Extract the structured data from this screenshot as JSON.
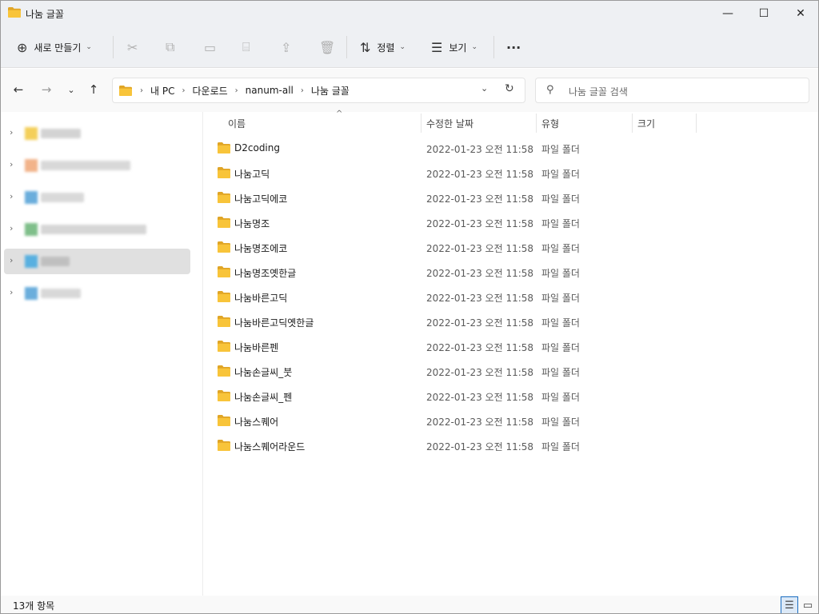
{
  "window": {
    "title": "나눔 글꼴",
    "controls": {
      "minimize": "—",
      "maximize": "☐",
      "close": "✕"
    }
  },
  "toolbar": {
    "new_label": "새로 만들기",
    "sort_label": "정렬",
    "view_label": "보기",
    "more": "···"
  },
  "address": {
    "crumbs": [
      "내 PC",
      "다운로드",
      "nanum-all",
      "나눔 글꼴"
    ],
    "separator": "›"
  },
  "search": {
    "placeholder": "나눔 글꼴 검색"
  },
  "columns": {
    "name": "이름",
    "date": "수정한 날짜",
    "type": "유형",
    "size": "크기"
  },
  "files": [
    {
      "name": "D2coding",
      "date": "2022-01-23 오전 11:58",
      "type": "파일 폴더"
    },
    {
      "name": "나눔고딕",
      "date": "2022-01-23 오전 11:58",
      "type": "파일 폴더"
    },
    {
      "name": "나눔고딕에코",
      "date": "2022-01-23 오전 11:58",
      "type": "파일 폴더"
    },
    {
      "name": "나눔명조",
      "date": "2022-01-23 오전 11:58",
      "type": "파일 폴더"
    },
    {
      "name": "나눔명조에코",
      "date": "2022-01-23 오전 11:58",
      "type": "파일 폴더"
    },
    {
      "name": "나눔명조옛한글",
      "date": "2022-01-23 오전 11:58",
      "type": "파일 폴더"
    },
    {
      "name": "나눔바른고딕",
      "date": "2022-01-23 오전 11:58",
      "type": "파일 폴더"
    },
    {
      "name": "나눔바른고딕옛한글",
      "date": "2022-01-23 오전 11:58",
      "type": "파일 폴더"
    },
    {
      "name": "나눔바른펜",
      "date": "2022-01-23 오전 11:58",
      "type": "파일 폴더"
    },
    {
      "name": "나눔손글씨_붓",
      "date": "2022-01-23 오전 11:58",
      "type": "파일 폴더"
    },
    {
      "name": "나눔손글씨_펜",
      "date": "2022-01-23 오전 11:58",
      "type": "파일 폴더"
    },
    {
      "name": "나눔스퀘어",
      "date": "2022-01-23 오전 11:58",
      "type": "파일 폴더"
    },
    {
      "name": "나눔스퀘어라운드",
      "date": "2022-01-23 오전 11:58",
      "type": "파일 폴더"
    }
  ],
  "status": {
    "item_count": "13개 항목"
  },
  "colors": {
    "folder_yellow": "#f8c43a",
    "folder_dark": "#e0a526",
    "selection_gray": "#e0e0e0",
    "accent_blue": "#1b6ec2"
  }
}
